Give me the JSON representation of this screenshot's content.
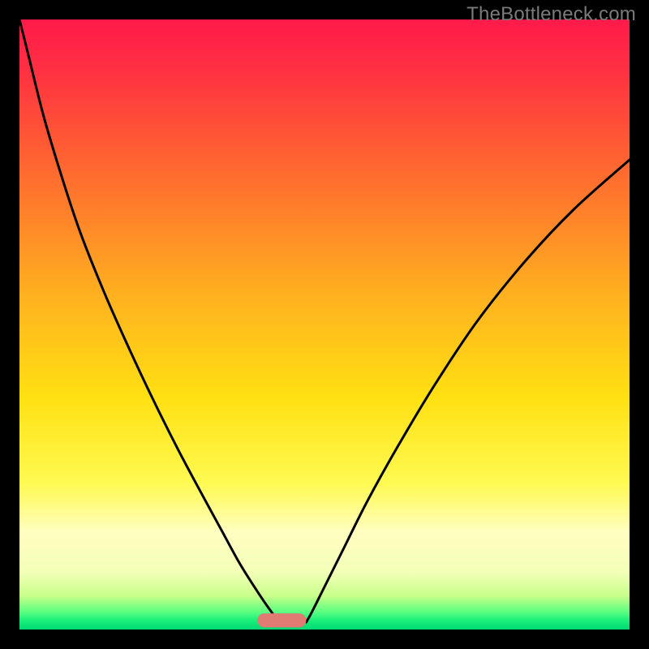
{
  "watermark": {
    "text": "TheBottleneck.com"
  },
  "chart_data": {
    "type": "line",
    "title": "",
    "xlabel": "",
    "ylabel": "",
    "xlim": [
      0,
      100
    ],
    "ylim": [
      0,
      100
    ],
    "background_gradient": {
      "stops": [
        {
          "offset": 0.0,
          "color": "#ff1a4a"
        },
        {
          "offset": 0.08,
          "color": "#ff2f42"
        },
        {
          "offset": 0.25,
          "color": "#ff6a2f"
        },
        {
          "offset": 0.45,
          "color": "#ffb020"
        },
        {
          "offset": 0.62,
          "color": "#ffe012"
        },
        {
          "offset": 0.76,
          "color": "#fffa52"
        },
        {
          "offset": 0.84,
          "color": "#fffec0"
        },
        {
          "offset": 0.905,
          "color": "#f4ffb8"
        },
        {
          "offset": 0.945,
          "color": "#c8ff8a"
        },
        {
          "offset": 0.97,
          "color": "#60ff82"
        },
        {
          "offset": 0.985,
          "color": "#1bf07a"
        },
        {
          "offset": 1.0,
          "color": "#00d874"
        }
      ]
    },
    "marker": {
      "x": 43,
      "y": 1.5,
      "width": 8,
      "height": 2.3,
      "color": "#df7b72",
      "rx": 1.15
    },
    "series": [
      {
        "name": "left-curve",
        "type": "curve",
        "x": [
          0,
          1.5,
          4,
          7,
          10,
          14,
          18,
          22,
          26,
          30,
          33,
          36,
          38.5,
          40.5,
          42,
          43
        ],
        "y": [
          100,
          94,
          84,
          74,
          65,
          55,
          46,
          37.5,
          29.5,
          22,
          16.5,
          11,
          7,
          4,
          2,
          1.2
        ]
      },
      {
        "name": "right-curve",
        "type": "curve",
        "x": [
          47,
          48,
          50,
          53,
          57,
          62,
          68,
          75,
          83,
          91,
          100
        ],
        "y": [
          1.2,
          3,
          7,
          13,
          21,
          30,
          40,
          50.5,
          60.5,
          69,
          77
        ]
      }
    ]
  }
}
